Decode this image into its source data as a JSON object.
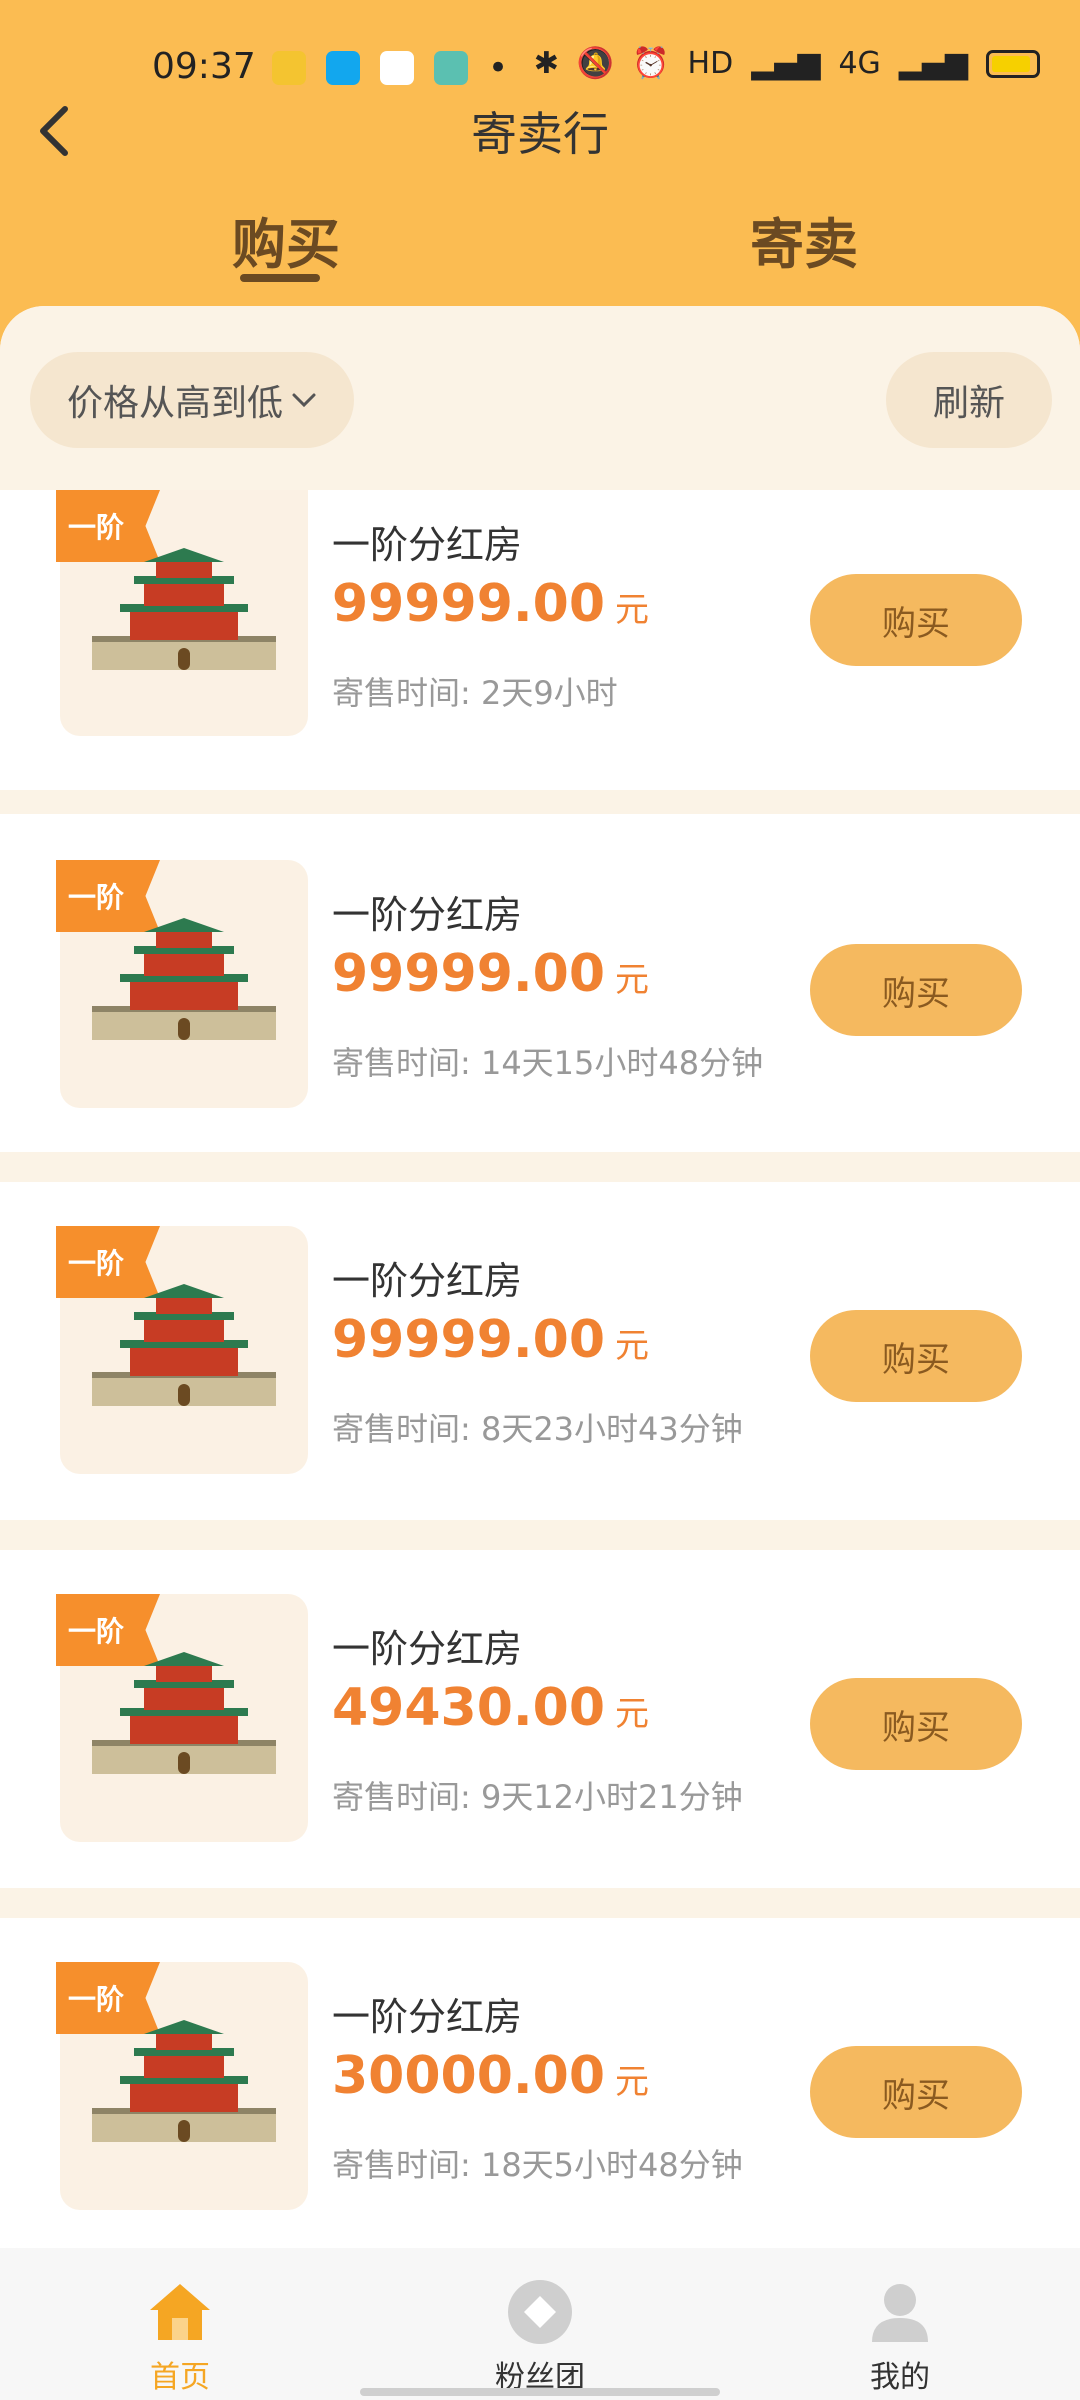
{
  "status_bar": {
    "time": "09:37",
    "right_text": "HD",
    "network": "4G",
    "accent": "#fbbc52"
  },
  "header": {
    "title": "寄卖行",
    "tabs": [
      {
        "label": "购买",
        "active": true
      },
      {
        "label": "寄卖",
        "active": false
      }
    ]
  },
  "toolbar": {
    "sort_label": "价格从高到低",
    "refresh_label": "刷新"
  },
  "items": [
    {
      "tag": "一阶",
      "name": "一阶分红房",
      "price": "99999.00",
      "unit": "元",
      "time": "寄售时间: 2天9小时",
      "button": "购买"
    },
    {
      "tag": "一阶",
      "name": "一阶分红房",
      "price": "99999.00",
      "unit": "元",
      "time": "寄售时间: 14天15小时48分钟",
      "button": "购买"
    },
    {
      "tag": "一阶",
      "name": "一阶分红房",
      "price": "99999.00",
      "unit": "元",
      "time": "寄售时间: 8天23小时43分钟",
      "button": "购买"
    },
    {
      "tag": "一阶",
      "name": "一阶分红房",
      "price": "49430.00",
      "unit": "元",
      "time": "寄售时间: 9天12小时21分钟",
      "button": "购买"
    },
    {
      "tag": "一阶",
      "name": "一阶分红房",
      "price": "30000.00",
      "unit": "元",
      "time": "寄售时间: 18天5小时48分钟",
      "button": "购买"
    }
  ],
  "bottom_nav": [
    {
      "label": "首页",
      "icon": "home-icon",
      "active": true,
      "color": "#f5a623"
    },
    {
      "label": "粉丝团",
      "icon": "diamond-icon",
      "active": false,
      "color": "#333333"
    },
    {
      "label": "我的",
      "icon": "user-icon",
      "active": false,
      "color": "#333333"
    }
  ]
}
